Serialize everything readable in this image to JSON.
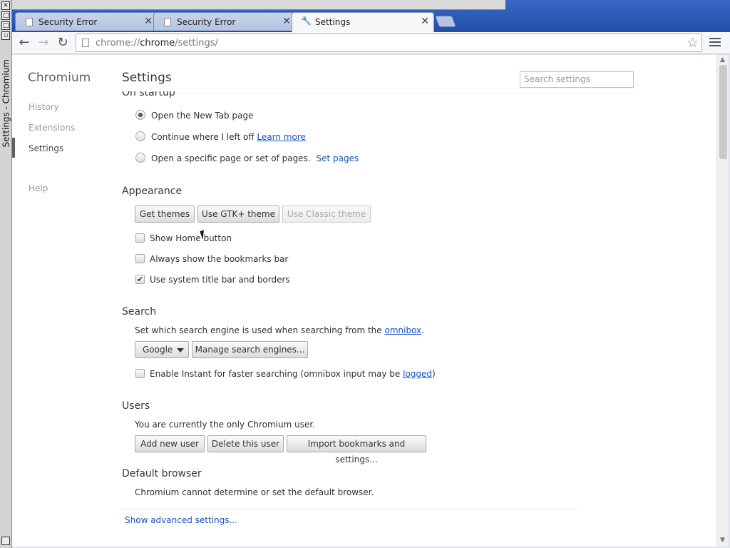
{
  "window": {
    "title": "Settings - Chromium"
  },
  "tabs": [
    {
      "title": "Security Error"
    },
    {
      "title": "Security Error"
    },
    {
      "title": "Settings"
    }
  ],
  "toolbar": {
    "url_prefix": "chrome://",
    "url_host": "chrome",
    "url_path": "/settings/"
  },
  "sidebar": {
    "app_title": "Chromium",
    "items": [
      {
        "label": "History"
      },
      {
        "label": "Extensions"
      },
      {
        "label": "Settings"
      },
      {
        "label": "Help"
      }
    ],
    "selected": "Settings"
  },
  "header": {
    "title": "Settings",
    "search_placeholder": "Search settings"
  },
  "on_startup": {
    "title": "On startup",
    "options": [
      {
        "label": "Open the New Tab page",
        "checked": true
      },
      {
        "label": "Continue where I left off",
        "link": "Learn more"
      },
      {
        "label": "Open a specific page or set of pages.",
        "link": "Set pages"
      }
    ]
  },
  "appearance": {
    "title": "Appearance",
    "buttons": [
      "Get themes",
      "Use GTK+ theme",
      "Use Classic theme"
    ],
    "checkboxes": [
      {
        "label": "Show Home button",
        "checked": false
      },
      {
        "label": "Always show the bookmarks bar",
        "checked": false
      },
      {
        "label": "Use system title bar and borders",
        "checked": true
      }
    ]
  },
  "search": {
    "title": "Search",
    "description_prefix": "Set which search engine is used when searching from the",
    "description_link": "omnibox",
    "description_suffix": ".",
    "engine": "Google",
    "manage_button": "Manage search engines...",
    "instant_label_prefix": "Enable Instant for faster searching (omnibox input may be",
    "instant_link": "logged",
    "instant_label_suffix": ")"
  },
  "users": {
    "title": "Users",
    "description": "You are currently the only Chromium user.",
    "buttons": [
      "Add new user",
      "Delete this user",
      "Import bookmarks and settings..."
    ]
  },
  "default_browser": {
    "title": "Default browser",
    "description": "Chromium cannot determine or set the default browser."
  },
  "footer": {
    "show_advanced": "Show advanced settings..."
  },
  "colors": {
    "frame": "#1f4ea9",
    "link": "#1155cc"
  }
}
